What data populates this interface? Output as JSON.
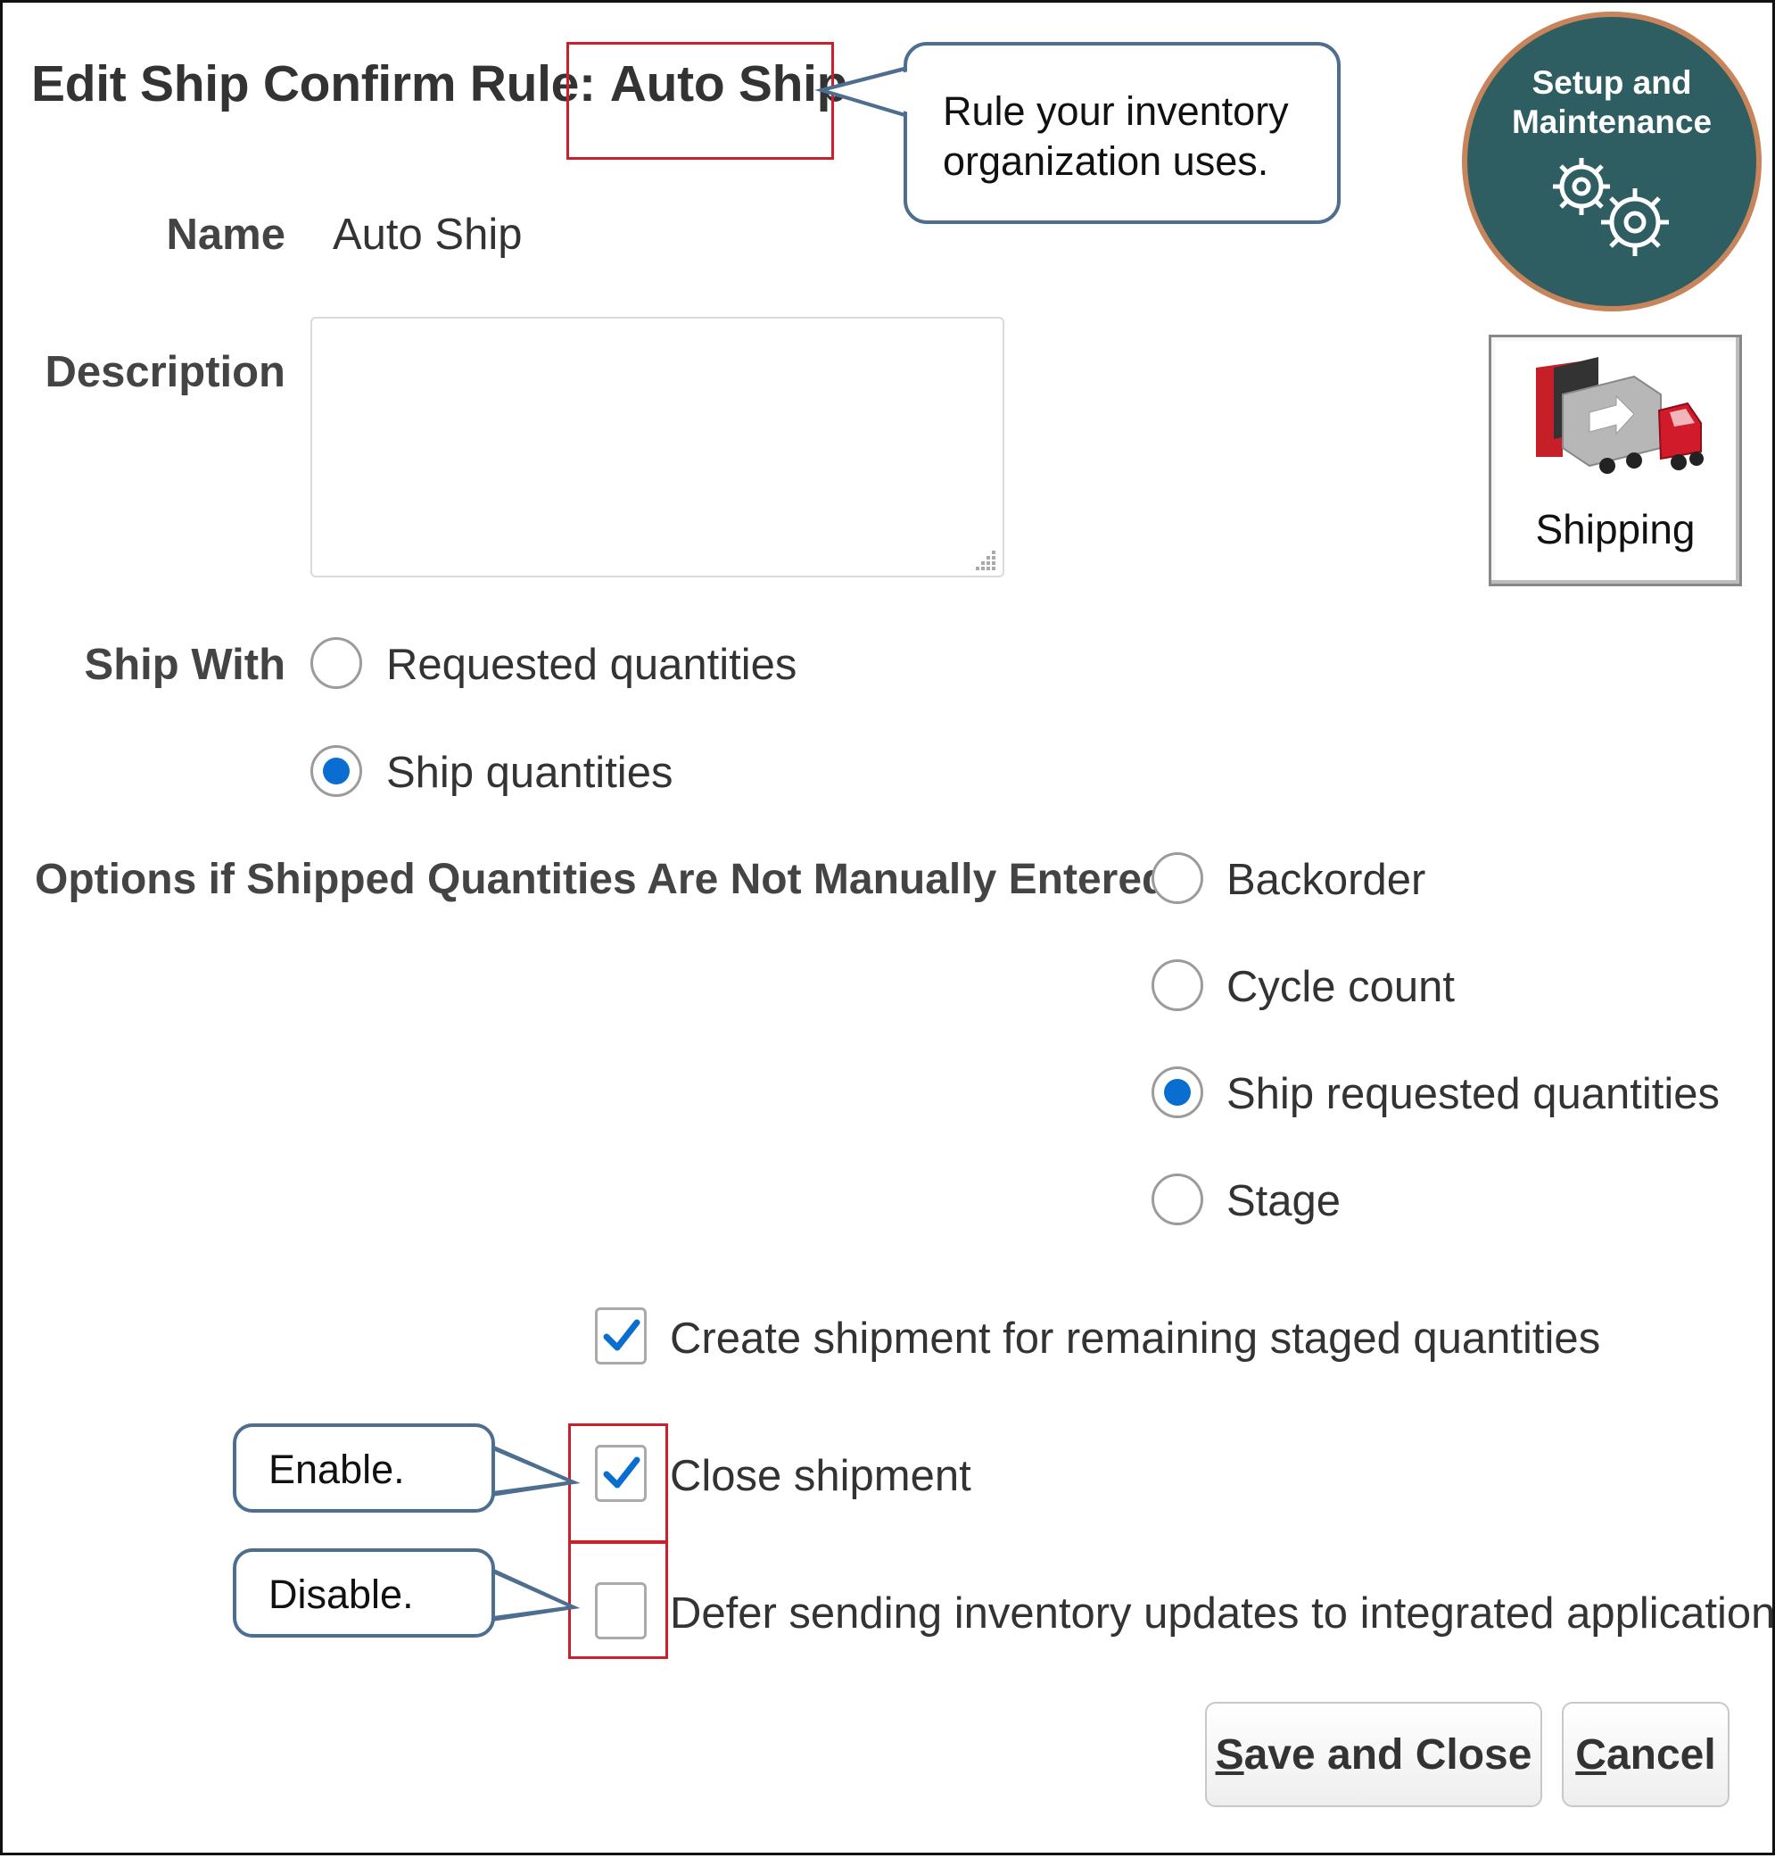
{
  "page": {
    "title_prefix": "Edit Ship Confirm Rule:",
    "title_name": "Auto Ship"
  },
  "callouts": {
    "rule": "Rule your inventory organization uses.",
    "enable": "Enable.",
    "disable": "Disable."
  },
  "fields": {
    "name_label": "Name",
    "name_value": "Auto Ship",
    "description_label": "Description",
    "description_value": "",
    "ship_with_label": "Ship With",
    "options_label": "Options if Shipped Quantities Are Not Manually Entered"
  },
  "ship_with_options": [
    {
      "label": "Requested quantities",
      "selected": false
    },
    {
      "label": "Ship quantities",
      "selected": true
    }
  ],
  "not_entered_options": [
    {
      "label": "Backorder",
      "selected": false
    },
    {
      "label": "Cycle count",
      "selected": false
    },
    {
      "label": "Ship requested quantities",
      "selected": true
    },
    {
      "label": "Stage",
      "selected": false
    }
  ],
  "checkboxes": [
    {
      "label": "Create shipment for remaining staged quantities",
      "checked": true
    },
    {
      "label": "Close shipment",
      "checked": true
    },
    {
      "label": "Defer sending inventory updates to integrated applications",
      "checked": false
    }
  ],
  "buttons": {
    "save_close_mnemonic": "S",
    "save_close_rest": "ave and Close",
    "cancel_mnemonic": "C",
    "cancel_rest": "ancel"
  },
  "badges": {
    "setup_line1": "Setup and",
    "setup_line2": "Maintenance",
    "shipping": "Shipping"
  },
  "colors": {
    "accent_radio": "#0a6ed1",
    "highlight_box": "#cc1f2b",
    "callout_border": "#4d6e8f",
    "setup_badge_bg": "#2e5e62",
    "setup_badge_ring": "#c8845a"
  },
  "icons": {
    "setup": "gears-icon",
    "shipping": "truck-loading-dock-icon",
    "check": "check-icon",
    "resize": "resize-grip-icon"
  }
}
